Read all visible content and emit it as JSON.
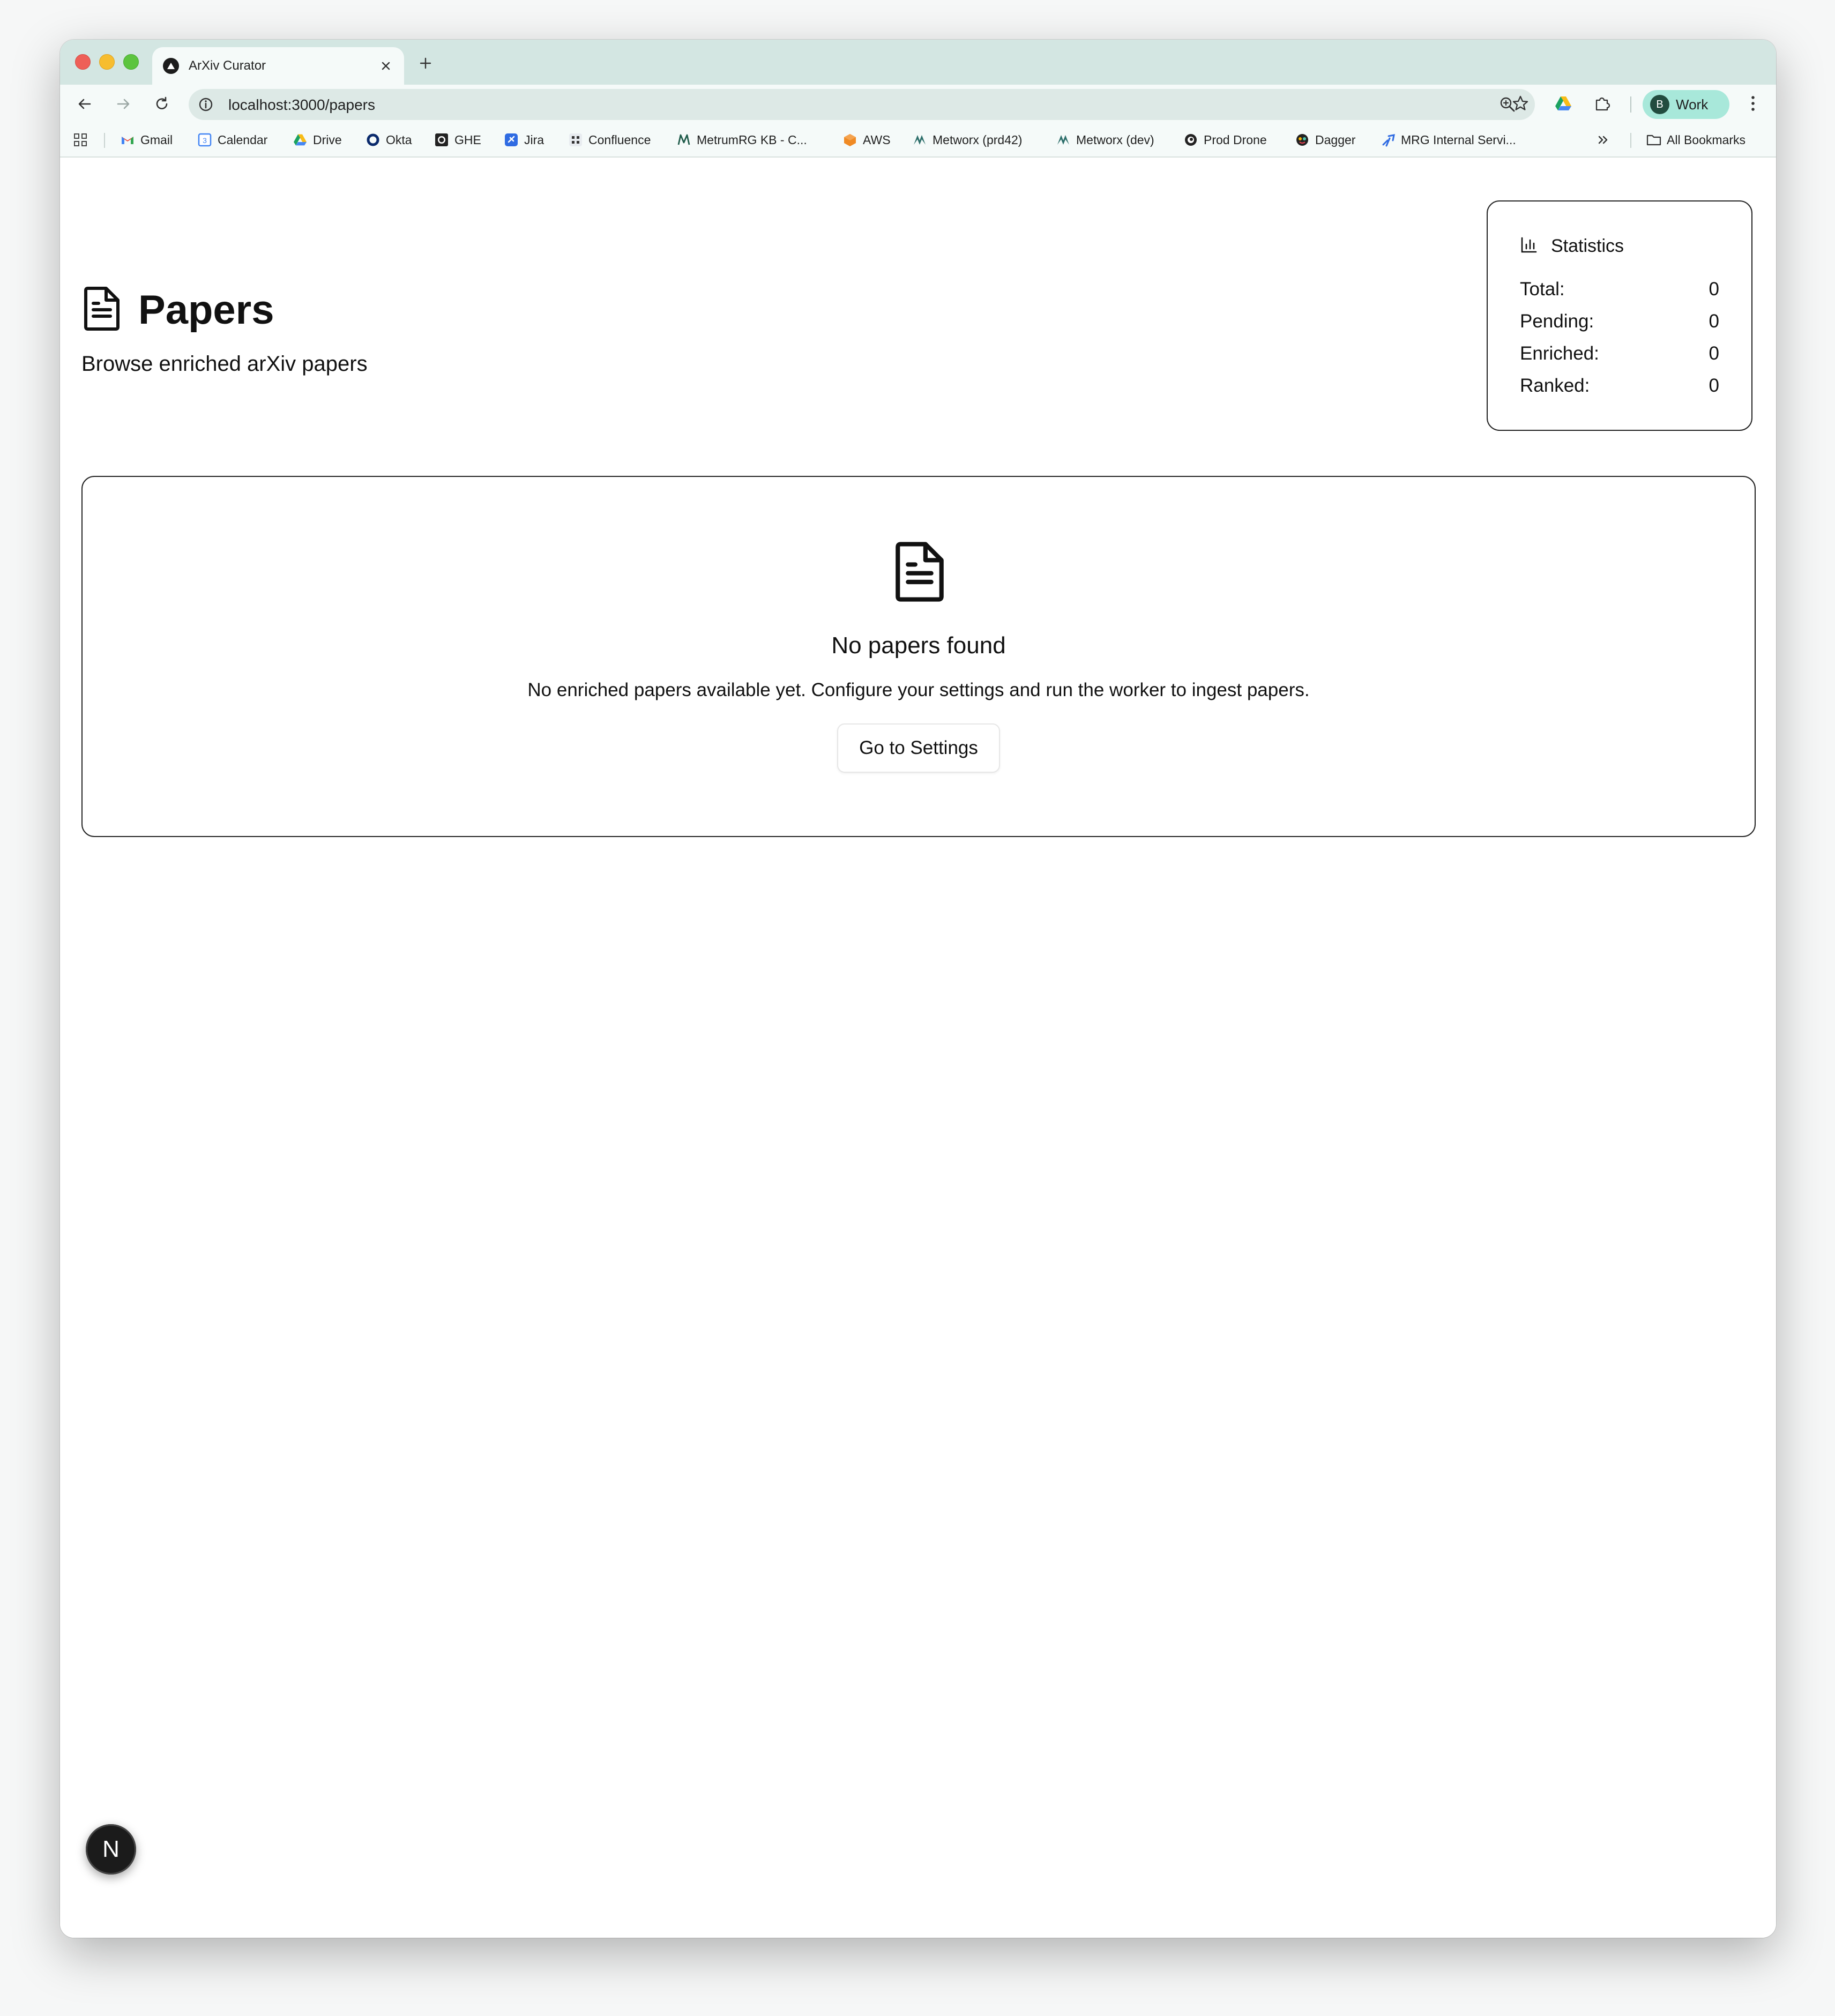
{
  "browser": {
    "tab_title": "ArXiv Curator",
    "url": "localhost:3000/papers",
    "profile_initial": "B",
    "profile_label": "Work",
    "bookmarks": [
      {
        "label": "Gmail",
        "icon": "gmail-icon"
      },
      {
        "label": "Calendar",
        "icon": "calendar-icon"
      },
      {
        "label": "Drive",
        "icon": "drive-icon"
      },
      {
        "label": "Okta",
        "icon": "okta-icon"
      },
      {
        "label": "GHE",
        "icon": "github-icon"
      },
      {
        "label": "Jira",
        "icon": "jira-icon"
      },
      {
        "label": "Confluence",
        "icon": "confluence-icon"
      },
      {
        "label": "MetrumRG KB - C...",
        "icon": "metrum-icon"
      },
      {
        "label": "AWS",
        "icon": "aws-icon"
      },
      {
        "label": "Metworx (prd42)",
        "icon": "metworx-icon"
      },
      {
        "label": "Metworx (dev)",
        "icon": "metworx-icon"
      },
      {
        "label": "Prod Drone",
        "icon": "drone-icon"
      },
      {
        "label": "Dagger",
        "icon": "dagger-icon"
      },
      {
        "label": "MRG Internal Servi...",
        "icon": "mrg-icon"
      }
    ],
    "all_bookmarks_label": "All Bookmarks"
  },
  "page": {
    "title": "Papers",
    "subtitle": "Browse enriched arXiv papers",
    "icon": "file-text-icon"
  },
  "stats": {
    "title": "Statistics",
    "icon": "bar-chart-icon",
    "rows": [
      {
        "label": "Total:",
        "value": "0"
      },
      {
        "label": "Pending:",
        "value": "0"
      },
      {
        "label": "Enriched:",
        "value": "0"
      },
      {
        "label": "Ranked:",
        "value": "0"
      }
    ]
  },
  "empty_state": {
    "title": "No papers found",
    "description": "No enriched papers available yet. Configure your settings and run the worker to ingest papers.",
    "button_label": "Go to Settings"
  },
  "dev_badge": {
    "label": "N"
  },
  "colors": {
    "tab_strip": "#d3e6e2",
    "toolbar": "#f5faf9",
    "profile_chip": "#a8e8da",
    "text": "#111111"
  }
}
